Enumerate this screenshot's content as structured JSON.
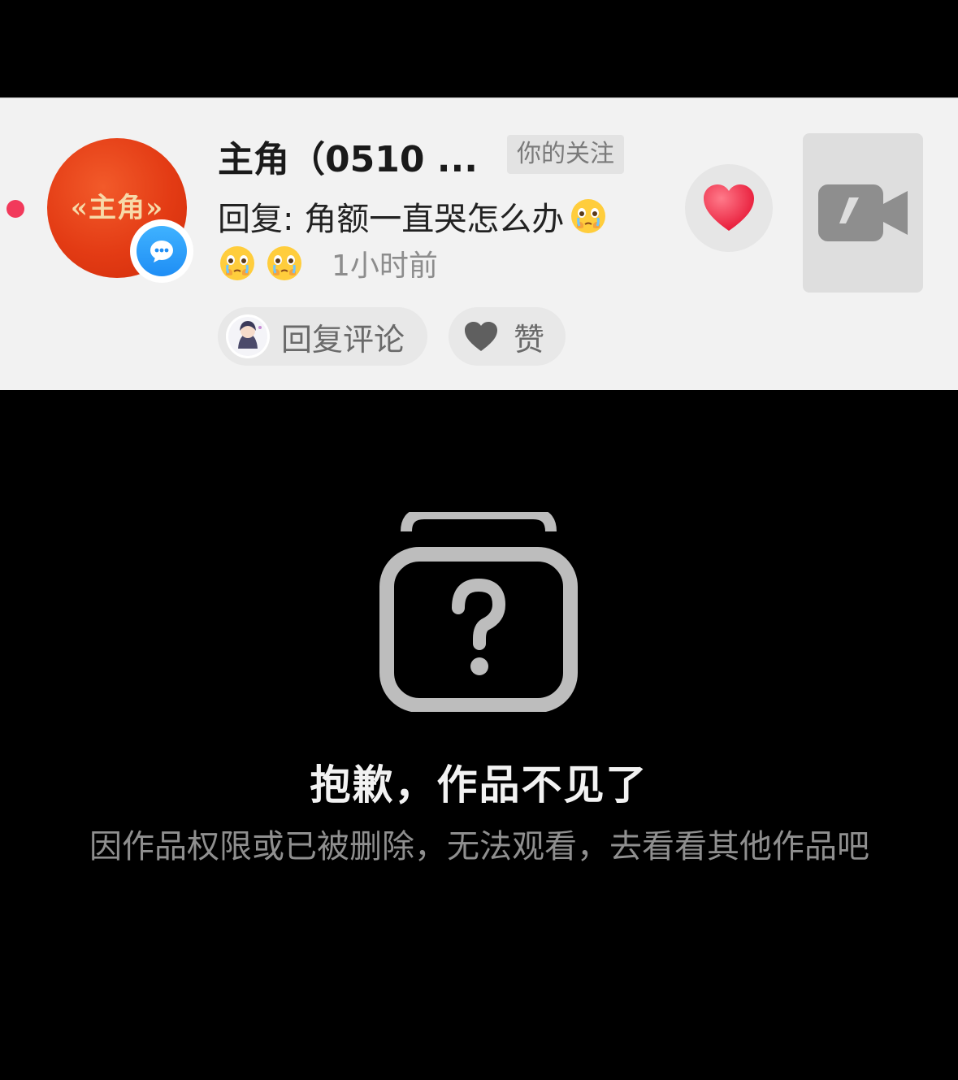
{
  "comment": {
    "username": "主角（0510 ...",
    "follow_tag": "你的关注",
    "avatar_text": "«主角»",
    "reply_text": "回复: 角额一直哭怎么办",
    "time": "1小时前",
    "reply_button": "回复评论",
    "like_button": "赞",
    "emoji": "crying-face",
    "colors": {
      "unread_dot": "#f23a5b",
      "avatar_bg": "#e33b14",
      "badge_bg": "#1f8ef5",
      "heart": "#f5304a"
    }
  },
  "error": {
    "title": "抱歉，作品不见了",
    "description": "因作品权限或已被删除，无法观看，去看看其他作品吧",
    "icon": "missing-video-icon"
  }
}
